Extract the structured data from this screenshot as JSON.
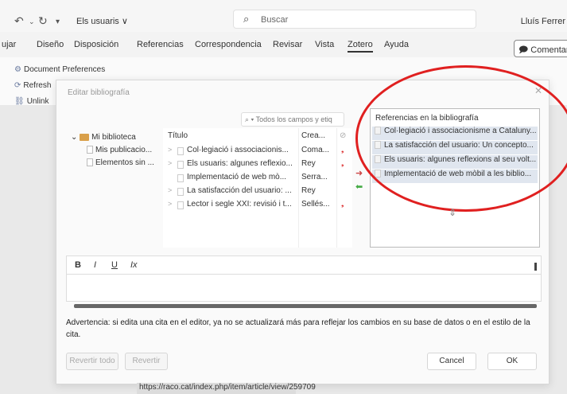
{
  "titlebar": {
    "doc_title": "Els usuaris ∨",
    "search_placeholder": "Buscar",
    "user": "Lluís Ferrer"
  },
  "tabs": [
    "ujar",
    "Diseño",
    "Disposición",
    "Referencias",
    "Correspondencia",
    "Revisar",
    "Vista",
    "Zotero",
    "Ayuda"
  ],
  "active_tab": "Zotero",
  "comment_button": "Comentar",
  "ribbon": {
    "doc_prefs": "Document Preferences",
    "refresh": "Refresh",
    "unlink": "Unlink"
  },
  "dialog": {
    "title": "Editar bibliografía",
    "search_placeholder": "Todos los campos y etiq",
    "tree": {
      "root": "Mi biblioteca",
      "children": [
        "Mis publicacio...",
        "Elementos sin ..."
      ]
    },
    "columns": {
      "title": "Título",
      "creator": "Crea..."
    },
    "items": [
      {
        "title": "Col·legiació i associacionis...",
        "creator": "Coma...",
        "mark": "❟"
      },
      {
        "title": "Els usuaris: algunes reflexio...",
        "creator": "Rey",
        "mark": "❟"
      },
      {
        "title": "Implementació de web mò...",
        "creator": "Serra...",
        "mark": ""
      },
      {
        "title": "La satisfacción del usuario: ...",
        "creator": "Rey",
        "mark": ""
      },
      {
        "title": "Lector i segle XXI: revisió i t...",
        "creator": "Sellés...",
        "mark": "❟"
      }
    ],
    "refs_heading": "Referencias en la bibliografía",
    "refs": [
      "Col·legiació i associacionisme a Cataluny...",
      "La satisfacción del usuario: Un concepto...",
      "Els usuaris: algunes reflexions al seu volt...",
      "Implementació de web mòbil a les biblio..."
    ],
    "editor_buttons": [
      "B",
      "I",
      "U",
      "Ix"
    ],
    "warning": "Advertencia: si edita una cita en el editor, ya no se actualizará más para reflejar los cambios en su base de datos o en el estilo de la cita.",
    "buttons": {
      "revert_all": "Revertir todo",
      "revert": "Revertir",
      "cancel": "Cancel",
      "ok": "OK"
    }
  },
  "status_url": "https://raco.cat/index.php/item/article/view/259709"
}
